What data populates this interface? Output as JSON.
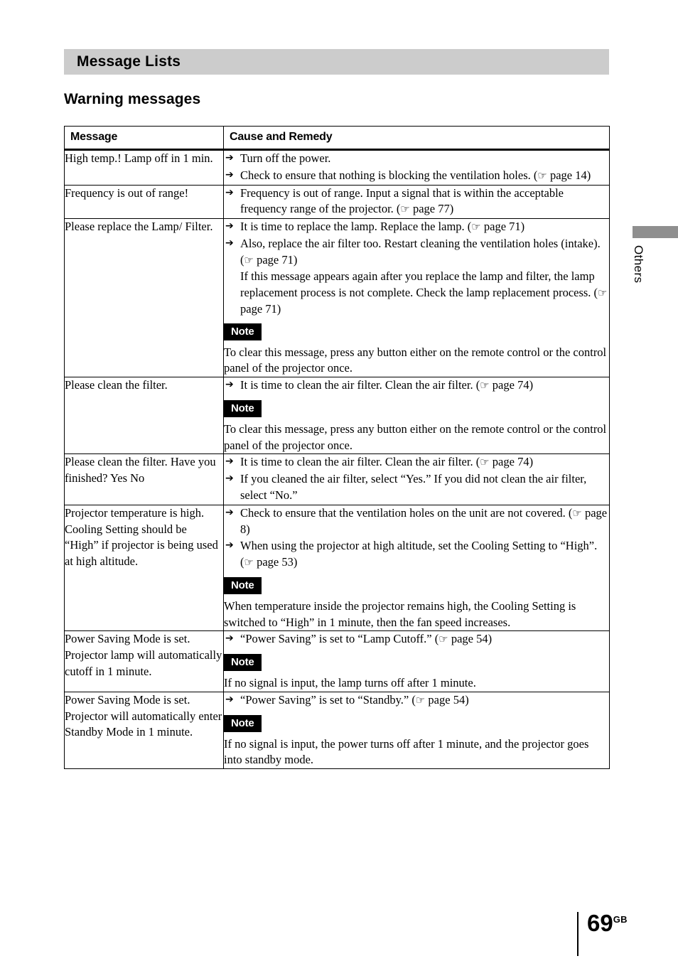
{
  "page": {
    "section_title": "Message Lists",
    "sub_heading": "Warning messages",
    "edge_label": "Others",
    "page_number": "69",
    "page_region": "GB",
    "arrow_glyph": "➔",
    "hand_glyph": "☞",
    "note_label": "Note",
    "colors": {
      "section_band": "#cccccc",
      "edge_tab": "#8f8f8f",
      "note_badge_bg": "#000000",
      "note_badge_text": "#ffffff",
      "text": "#000000"
    }
  },
  "table": {
    "headers": {
      "message": "Message",
      "cause": "Cause and Remedy"
    },
    "rows": [
      {
        "message": "High temp.! Lamp off in 1 min.",
        "bullets": [
          "Turn off the power.",
          "Check to ensure that nothing is blocking the ventilation holes. (☞ page 14)"
        ],
        "extra_lines": [],
        "note": null
      },
      {
        "message": "Frequency is out of range!",
        "bullets": [
          "Frequency is out of range. Input a signal that is within the acceptable frequency range of the projector. (☞ page 77)"
        ],
        "extra_lines": [],
        "note": null
      },
      {
        "message": "Please replace the Lamp/ Filter.",
        "bullets": [
          "It is time to replace the lamp. Replace the lamp. (☞ page 71)",
          "Also, replace the air filter too. Restart cleaning the ventilation holes (intake). (☞ page 71)"
        ],
        "extra_lines": [
          "If this message appears again after you replace the lamp and filter, the lamp replacement process is not complete. Check the lamp replacement process. (☞ page 71)"
        ],
        "note": "To clear this message, press any button either on the remote control or the control panel of the projector once."
      },
      {
        "message": "Please clean the filter.",
        "bullets": [
          "It is time to clean the air filter. Clean the air filter. (☞ page 74)"
        ],
        "extra_lines": [],
        "note": "To clear this message, press any button either on the remote control or the control panel of the projector once."
      },
      {
        "message": "Please clean the filter. Have you finished? Yes No",
        "bullets": [
          "It is time to clean the air filter. Clean the air filter. (☞ page 74)",
          "If you cleaned the air filter, select “Yes.” If you did not clean the air filter, select “No.”"
        ],
        "extra_lines": [],
        "note": null
      },
      {
        "message": "Projector temperature is high. Cooling Setting should be “High” if projector is being used at high altitude.",
        "bullets": [
          "Check to ensure that the ventilation holes on the unit are not covered. (☞ page 8)",
          "When using the projector at high altitude, set the Cooling Setting to “High”. (☞ page 53)"
        ],
        "extra_lines": [],
        "note": "When temperature inside the projector remains high, the Cooling Setting is switched to “High” in 1 minute, then the fan speed increases."
      },
      {
        "message": "Power Saving Mode is set. Projector lamp will automatically cutoff in 1 minute.",
        "bullets": [
          "“Power Saving” is set to “Lamp Cutoff.” (☞ page 54)"
        ],
        "extra_lines": [],
        "note": "If no signal is input, the lamp turns off after 1 minute."
      },
      {
        "message": "Power Saving Mode is set. Projector will automatically enter Standby Mode in 1 minute.",
        "bullets": [
          "“Power Saving” is set to “Standby.” (☞ page 54)"
        ],
        "extra_lines": [],
        "note": "If no signal is input, the power turns off after 1 minute, and the projector goes into standby mode."
      }
    ]
  }
}
